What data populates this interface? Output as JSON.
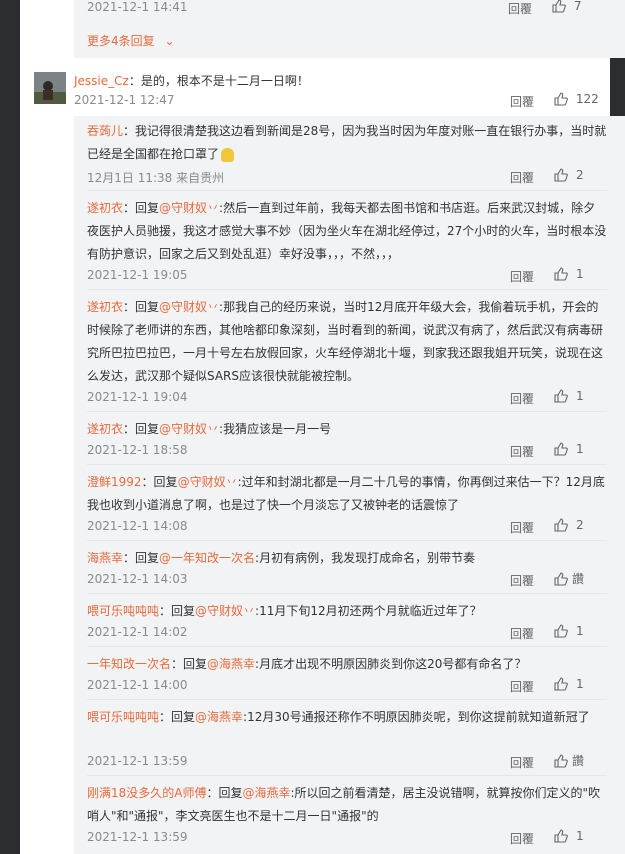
{
  "top_comment": {
    "time": "2021-12-1 14:41",
    "reply_label": "回覆",
    "likes": "7",
    "more_replies": "更多4条回复"
  },
  "main_comment": {
    "user": "Jessie_Cz",
    "text": "：是的，根本不是十二月一日啊！",
    "time": "2021-12-1 12:47",
    "reply_label": "回覆",
    "likes": "122"
  },
  "replies": [
    {
      "user": "吞蒟儿",
      "text": "：我记得很清楚我这边看到新闻是28号，因为我当时因为年度对账一直在银行办事，当时就已经是全国都在抢口罩了",
      "time": "12月1日 11:38 来自贵州",
      "reply_label": "回覆",
      "likes": "2"
    },
    {
      "user": "遂初衣",
      "prefix": "：回复",
      "mention": "@守财奴丷",
      "text": ":然后一直到过年前，我每天都去图书馆和书店逛。后来武汉封城，除夕夜医护人员驰援，我这才感觉大事不妙（因为坐火车在湖北经停过，27个小时的火车，当时根本没有防护意识，回家之后又到处乱逛）幸好没事，，，不然，，，",
      "time": "2021-12-1 19:05",
      "reply_label": "回覆",
      "likes": "1"
    },
    {
      "user": "遂初衣",
      "prefix": "：回复",
      "mention": "@守财奴丷",
      "text": ":那我自己的经历来说，当时12月底开年级大会，我偷着玩手机，开会的时候除了老师讲的东西，其他啥都印象深刻，当时看到的新闻，说武汉有病了，然后武汉有病毒研究所巴拉巴拉巴，一月十号左右放假回家，火车经停湖北十堰，到家我还跟我姐开玩笑，说现在这么发达，武汉那个疑似SARS应该很快就能被控制。",
      "time": "2021-12-1 19:04",
      "reply_label": "回覆",
      "likes": "1"
    },
    {
      "user": "遂初衣",
      "prefix": "：回复",
      "mention": "@守财奴丷",
      "text": ":我猜应该是一月一号",
      "time": "2021-12-1 18:58",
      "reply_label": "回覆",
      "likes": "1"
    },
    {
      "user": "澄鲜1992",
      "prefix": "：回复",
      "mention": "@守财奴丷",
      "text": ":过年和封湖北都是一月二十几号的事情，你再倒过来估一下？12月底我也收到小道消息了啊，也是过了快一个月淡忘了又被钟老的话震惊了",
      "time": "2021-12-1 14:08",
      "reply_label": "回覆",
      "likes": "2"
    },
    {
      "user": "海燕幸",
      "prefix": "：回复",
      "mention": "@一年知改一次名",
      "text": ":月初有病例，我发现打成命名，别带节奏",
      "time": "2021-12-1 14:03",
      "reply_label": "回覆",
      "likes": "讚"
    },
    {
      "user": "喂可乐吨吨吨",
      "prefix": "：回复",
      "mention": "@守财奴丷",
      "text": ":11月下旬12月初还两个月就临近过年了？",
      "time": "2021-12-1 14:02",
      "reply_label": "回覆",
      "likes": "1"
    },
    {
      "user": "一年知改一次名",
      "prefix": "：回复",
      "mention": "@海燕幸",
      "text": ":月底才出现不明原因肺炎到你这20号都有命名了？",
      "time": "2021-12-1 14:00",
      "reply_label": "回覆",
      "likes": "1"
    },
    {
      "user": "喂可乐吨吨吨",
      "prefix": "：回复",
      "mention": "@海燕幸",
      "text": ":12月30号通报还称作不明原因肺炎呢，到你这提前就知道新冠了",
      "time": "2021-12-1 13:59",
      "reply_label": "回覆",
      "likes": "讚"
    },
    {
      "user": "刚满18没多久的A师傅",
      "prefix": "：回复",
      "mention": "@海燕幸",
      "text": ":所以回之前看清楚，居主没说错啊，就算按你们定义的\"吹哨人\"和\"通报\"，李文亮医生也不是十二月一日\"通报\"的",
      "time": "2021-12-1 13:59",
      "reply_label": "回覆",
      "likes": "1"
    }
  ],
  "colors": {
    "accent": "#e86a3c",
    "muted": "#8a8a8a",
    "panel": "#f2f3f5"
  }
}
